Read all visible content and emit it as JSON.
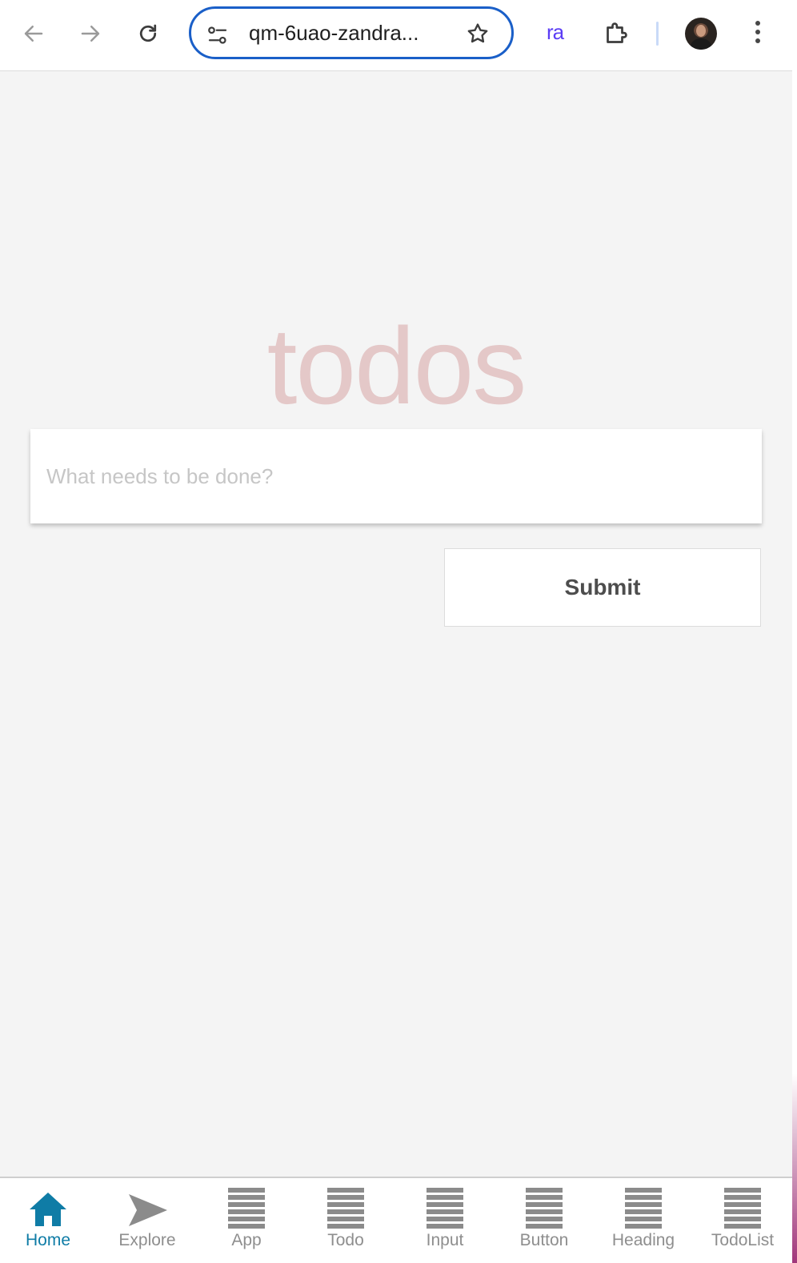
{
  "browser": {
    "url_text": "qm-6uao-zandra...",
    "extension_label": "ra",
    "colors": {
      "omnibox_border": "#1a5fc8",
      "extension_text": "#5b3df5"
    }
  },
  "app": {
    "title": "todos",
    "input_placeholder": "What needs to be done?",
    "input_value": "",
    "submit_label": "Submit",
    "colors": {
      "title": "#e4c8c8",
      "background": "#f4f4f4"
    }
  },
  "tabs": [
    {
      "label": "Home",
      "icon": "house-icon",
      "active": true
    },
    {
      "label": "Explore",
      "icon": "send-icon",
      "active": false
    },
    {
      "label": "App",
      "icon": "list-icon",
      "active": false
    },
    {
      "label": "Todo",
      "icon": "list-icon",
      "active": false
    },
    {
      "label": "Input",
      "icon": "list-icon",
      "active": false
    },
    {
      "label": "Button",
      "icon": "list-icon",
      "active": false
    },
    {
      "label": "Heading",
      "icon": "list-icon",
      "active": false
    },
    {
      "label": "TodoList",
      "icon": "list-icon",
      "active": false
    }
  ],
  "tab_colors": {
    "active": "#0f7ca6",
    "inactive": "#8e8e8e"
  }
}
